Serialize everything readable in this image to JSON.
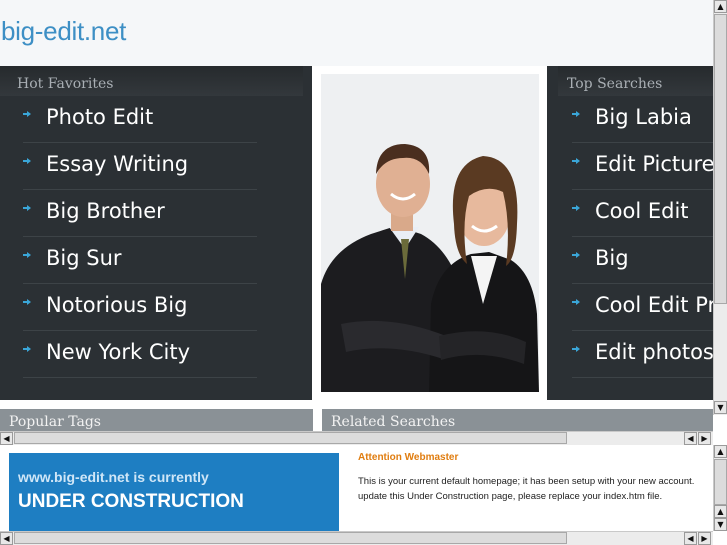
{
  "site": {
    "title": "big-edit.net"
  },
  "hot_favorites": {
    "heading": "Hot Favorites",
    "items": [
      "Photo Edit",
      "Essay Writing",
      "Big Brother",
      "Big Sur",
      "Notorious Big",
      "New York City"
    ]
  },
  "top_searches": {
    "heading": "Top Searches",
    "items": [
      "Big Labia",
      "Edit Pictures",
      "Cool Edit",
      "Big",
      "Cool Edit Pro",
      "Edit photos"
    ]
  },
  "bottom_bars": {
    "popular_tags": "Popular Tags",
    "related_searches": "Related Searches"
  },
  "construction": {
    "line1": "www.big-edit.net is currently",
    "line2": "UNDER CONSTRUCTION"
  },
  "attention": {
    "title": "Attention Webmaster",
    "text": "This is your current default homepage; it has been setup with your new account. update this Under Construction page, please replace your index.htm file."
  },
  "colors": {
    "brand_blue": "#3d8fc5",
    "panel_dark": "#2b3034",
    "arrow": "#3aa6d8",
    "construction_bg": "#1e7ec2",
    "attention": "#e07d10"
  },
  "icons": {
    "list_bullet": "arrow-right-icon"
  }
}
